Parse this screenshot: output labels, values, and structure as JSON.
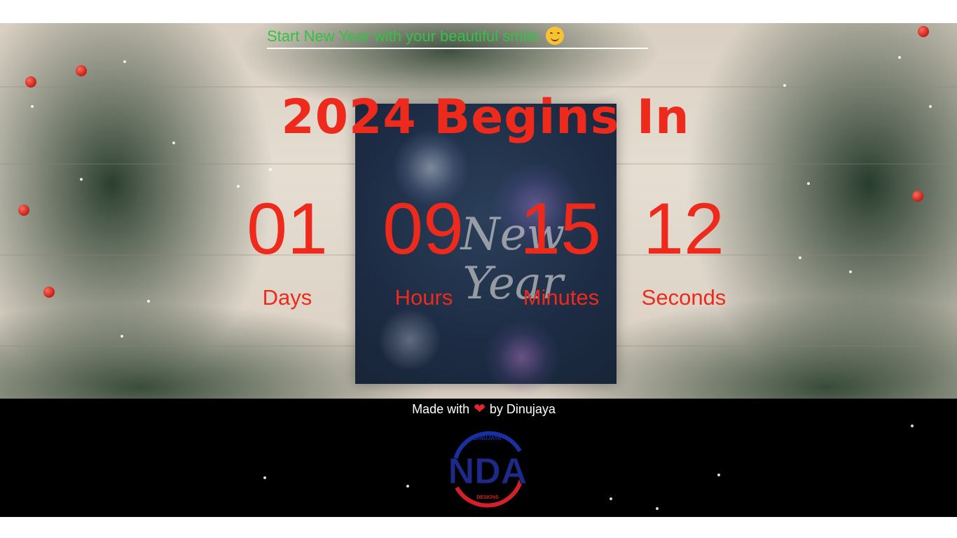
{
  "header": {
    "tagline": "Start New Year with your beautiful smile.",
    "tagline_emoji": "smiley-icon"
  },
  "countdown": {
    "title": "2024 Begins In",
    "days": {
      "value": "01",
      "label": "Days"
    },
    "hours": {
      "value": "09",
      "label": "Hours"
    },
    "minutes": {
      "value": "15",
      "label": "Minutes"
    },
    "seconds": {
      "value": "12",
      "label": "Seconds"
    }
  },
  "background": {
    "card_text": "New Year"
  },
  "footer": {
    "made_with": "Made with",
    "heart_icon": "heart-icon",
    "by": "by Dinujaya",
    "logo_letters": "NDA",
    "logo_top_text": "DINUJAYA",
    "logo_bottom_text": "DESIGNS"
  },
  "colors": {
    "accent_red": "#ee2a1c",
    "tagline_green": "#33c244",
    "footer_bg": "#000000"
  }
}
